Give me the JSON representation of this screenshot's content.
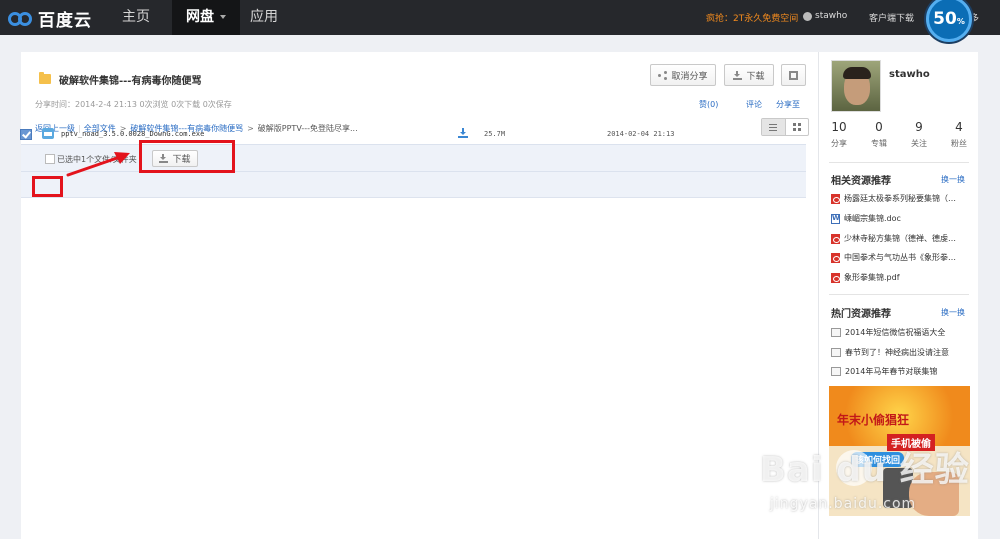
{
  "app": {
    "logo_text": "百度云"
  },
  "nav": {
    "items": [
      {
        "label": "主页"
      },
      {
        "label": "网盘"
      },
      {
        "label": "应用"
      }
    ]
  },
  "topbar": {
    "promo": "疯抢：2T永久免费空间",
    "username": "stawho",
    "client_download": "客户端下载",
    "more": "多",
    "badge_value": "50",
    "badge_unit": "%"
  },
  "share": {
    "title": "破解软件集锦---有病毒你随便骂",
    "cancel_share_label": "取消分享",
    "download_label": "下载",
    "meta": "分享时间：2014-2-4 21:13 0次浏览 0次下载 0次保存",
    "like_label": "赞(0)",
    "comment_label": "评论",
    "share_to_label": "分享至"
  },
  "breadcrumb": {
    "back": "返回上一级",
    "all_files": "全部文件",
    "folder": "破解软件集锦---有病毒你随便骂",
    "current": "破解版PPTV---免登陆尽享..."
  },
  "toolbar": {
    "selected_text": "已选中1个文件/文件夹",
    "download_label": "下载"
  },
  "files": [
    {
      "name": "pptv_noad_3.5.0.0028_DownG.com.exe",
      "size": "25.7M",
      "date": "2014-02-04 21:13"
    }
  ],
  "profile": {
    "name": "stawho",
    "stats": [
      {
        "value": "10",
        "label": "分享"
      },
      {
        "value": "0",
        "label": "专辑"
      },
      {
        "value": "9",
        "label": "关注"
      },
      {
        "value": "4",
        "label": "粉丝"
      }
    ]
  },
  "related": {
    "title": "相关资源推荐",
    "refresh": "换一换",
    "items": [
      {
        "label": "杨露廷太极拳系列秘要集锦（…",
        "icon": "pdf-icon"
      },
      {
        "label": "嵊嵋宗集锦.doc",
        "icon": "doc-icon"
      },
      {
        "label": "少林寺秘方集锦（德禅、德虔…",
        "icon": "pdf-icon"
      },
      {
        "label": "中国拳术与气功丛书《象形拳…",
        "icon": "pdf-icon"
      },
      {
        "label": "象形拳集锦.pdf",
        "icon": "pdf-icon"
      }
    ]
  },
  "hot": {
    "title": "热门资源推荐",
    "refresh": "换一换",
    "items": [
      {
        "label": "2014年短信微信祝福语大全"
      },
      {
        "label": "春节到了！神经病出没请注意"
      },
      {
        "label": "2014年马年春节对联集锦"
      }
    ]
  },
  "ad": {
    "line1": "年末小偷猖狂",
    "line2": "手机被偷",
    "line3": "该如何找回"
  },
  "watermark": {
    "main": "Bai du 经验",
    "sub": "jingyan.baidu.com"
  },
  "colors": {
    "topbar": "#26282c",
    "link": "#2a6cc3",
    "promo": "#f18a1e",
    "annotation_red": "#e3131c"
  }
}
